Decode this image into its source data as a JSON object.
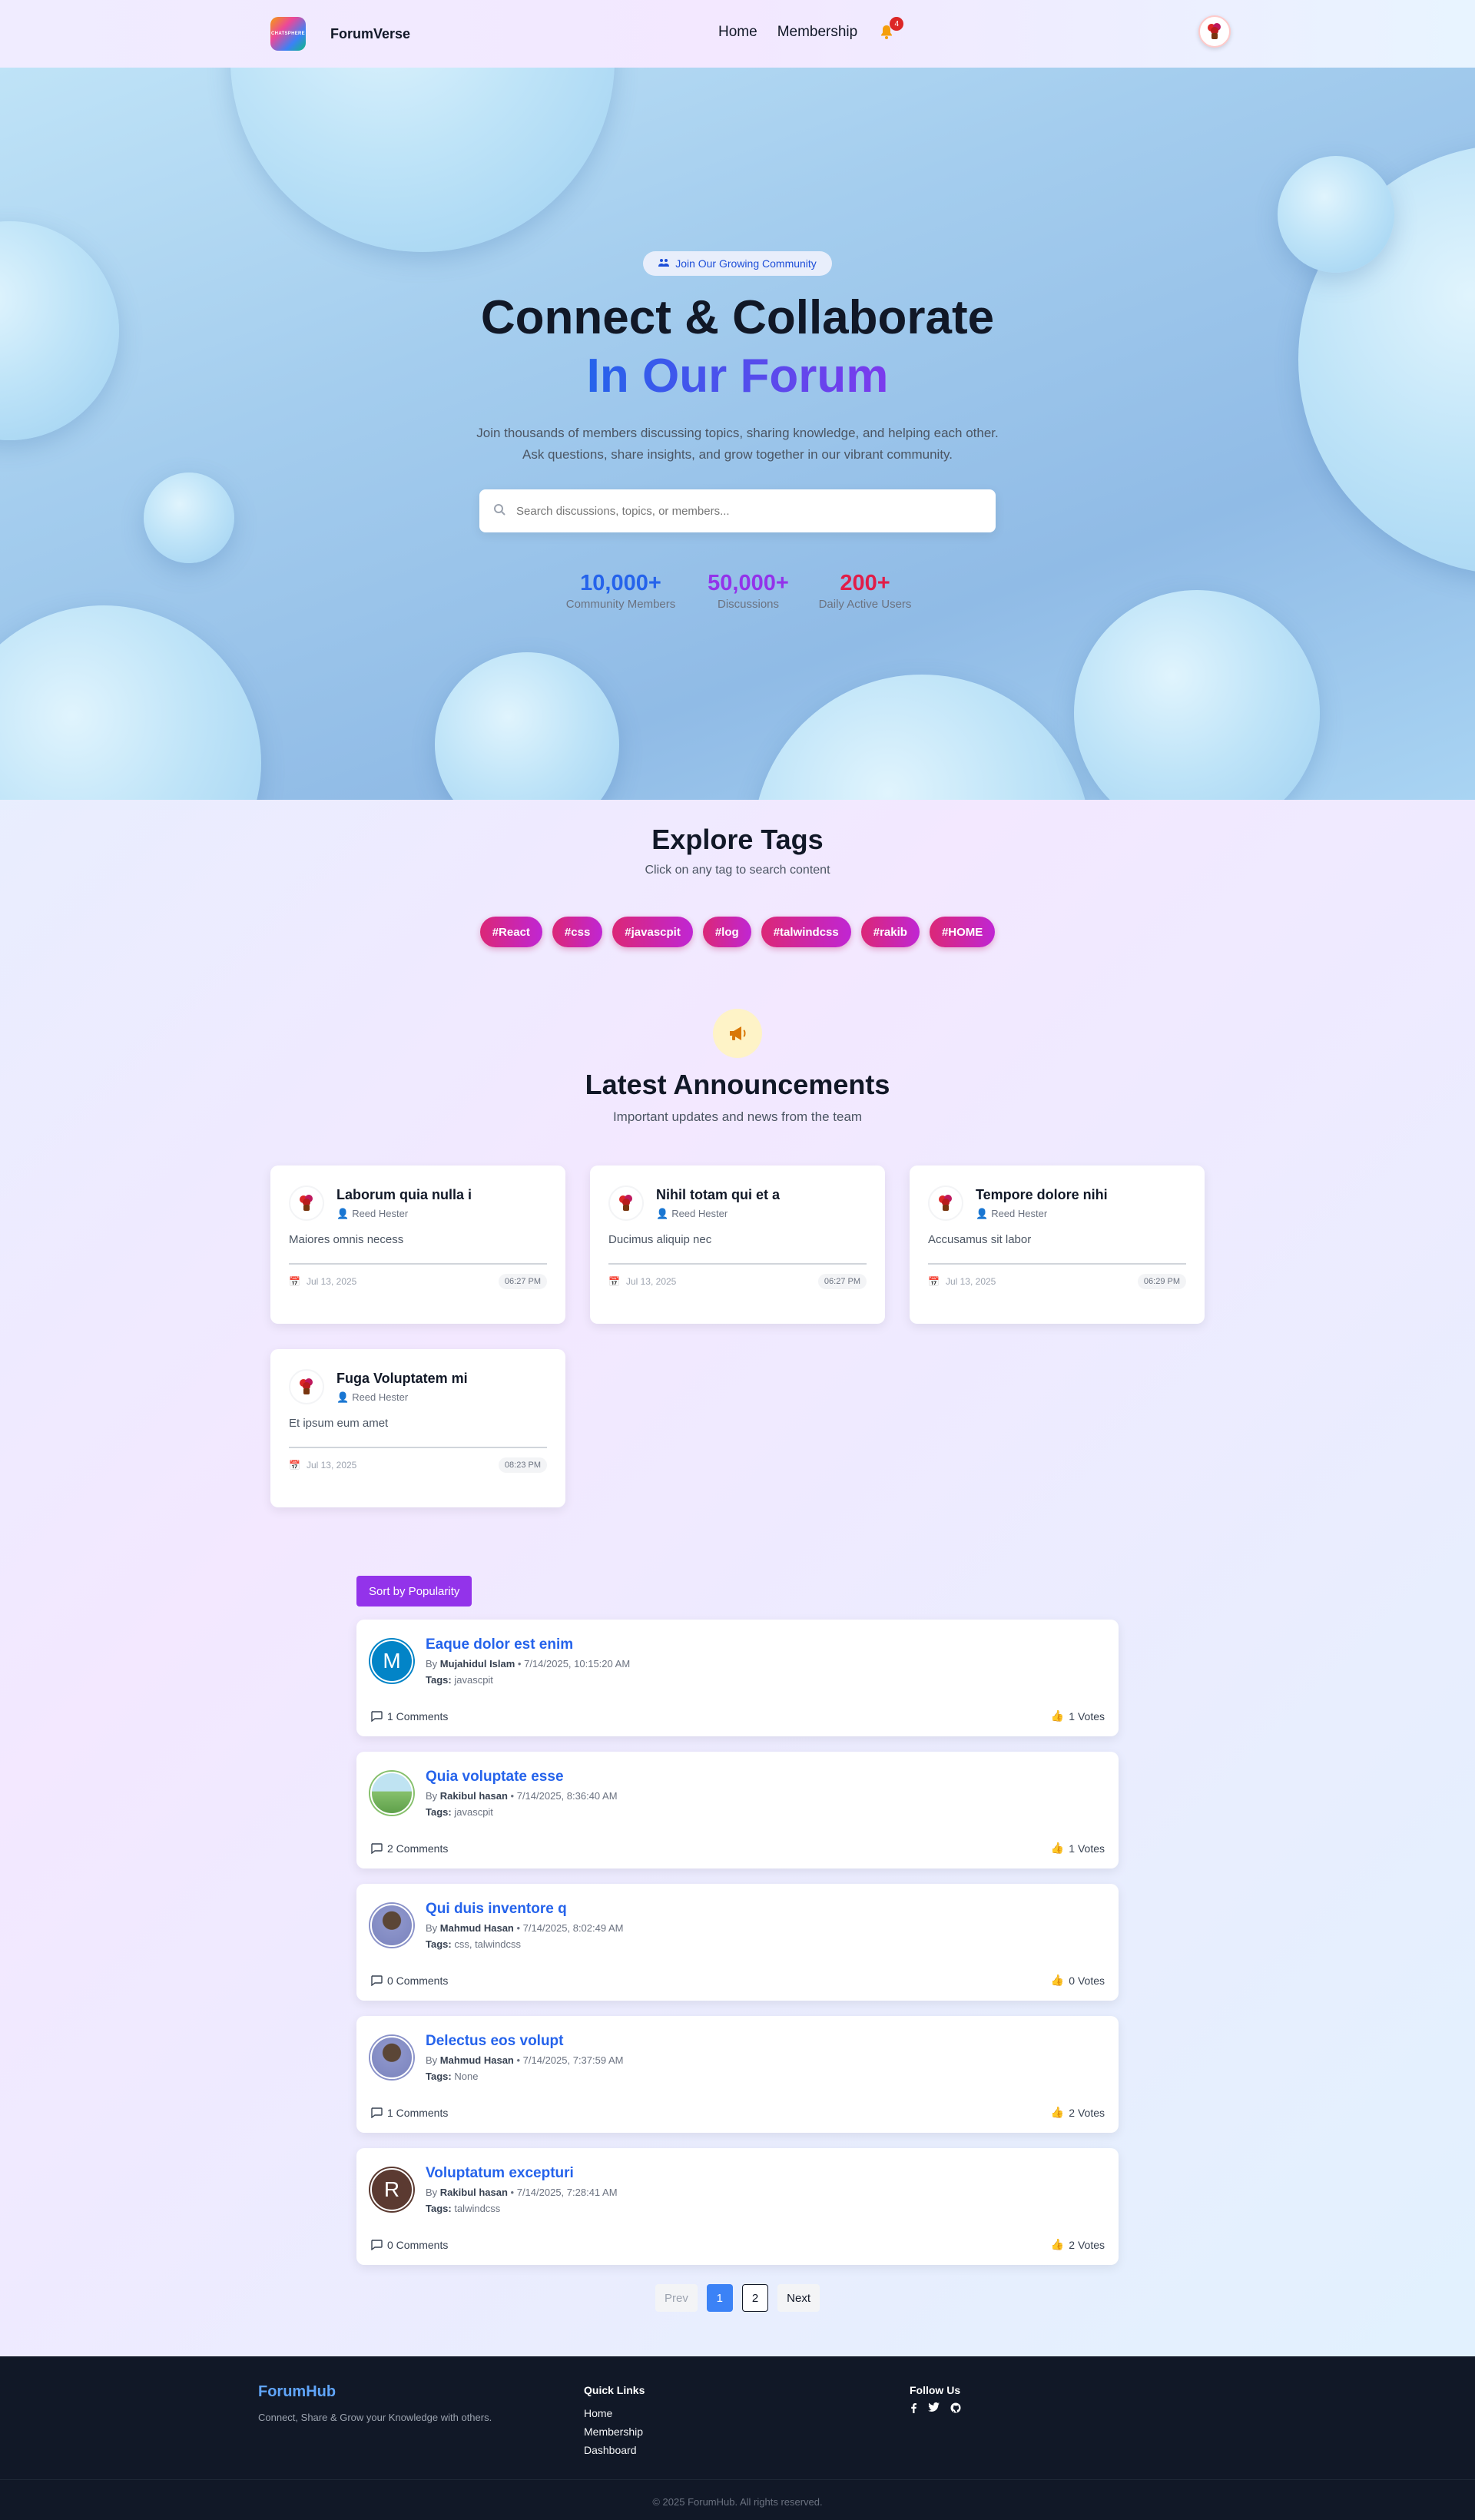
{
  "nav": {
    "logo_text": "CHATSPHERE",
    "brand": "ForumVerse",
    "links": [
      "Home",
      "Membership"
    ],
    "notification_count": "4"
  },
  "hero": {
    "badge": "Join Our Growing Community",
    "title_line1": "Connect & Collaborate",
    "title_line2": "In Our Forum",
    "description": "Join thousands of members discussing topics, sharing knowledge, and helping each other. Ask questions, share insights, and grow together in our vibrant community.",
    "search_placeholder": "Search discussions, topics, or members...",
    "stats": [
      {
        "value": "10,000+",
        "label": "Community Members",
        "color": "#2563eb"
      },
      {
        "value": "50,000+",
        "label": "Discussions",
        "color": "#9333ea"
      },
      {
        "value": "200+",
        "label": "Daily Active Users",
        "color": "#e11d48"
      }
    ]
  },
  "tags_section": {
    "title": "Explore Tags",
    "subtitle": "Click on any tag to search content",
    "tags": [
      "#React",
      "#css",
      "#javascpit",
      "#log",
      "#talwindcss",
      "#rakib",
      "#HOME"
    ]
  },
  "announcements": {
    "title": "Latest Announcements",
    "subtitle": "Important updates and news from the team",
    "items": [
      {
        "title": "Laborum quia nulla i",
        "author": "Reed Hester",
        "body": "Maiores omnis necess",
        "date": "Jul 13, 2025",
        "time": "06:27 PM"
      },
      {
        "title": "Nihil totam qui et a",
        "author": "Reed Hester",
        "body": "Ducimus aliquip nec",
        "date": "Jul 13, 2025",
        "time": "06:27 PM"
      },
      {
        "title": "Tempore dolore nihi",
        "author": "Reed Hester",
        "body": "Accusamus sit labor",
        "date": "Jul 13, 2025",
        "time": "06:29 PM"
      },
      {
        "title": "Fuga Voluptatem mi",
        "author": "Reed Hester",
        "body": "Et ipsum eum amet",
        "date": "Jul 13, 2025",
        "time": "08:23 PM"
      }
    ]
  },
  "posts": {
    "sort_label": "Sort by Popularity",
    "by_prefix": "By",
    "tags_prefix": "Tags:",
    "items": [
      {
        "title": "Eaque dolor est enim",
        "author": "Mujahidul Islam",
        "datetime": "7/14/2025, 10:15:20 AM",
        "tags": "javascpit",
        "comments": "1 Comments",
        "votes": "1 Votes",
        "avatar_letter": "M",
        "avatar_color": "#0284c7"
      },
      {
        "title": "Quia voluptate esse",
        "author": "Rakibul hasan",
        "datetime": "7/14/2025, 8:36:40 AM",
        "tags": "javascpit",
        "comments": "2 Comments",
        "votes": "1 Votes",
        "avatar_letter": "",
        "avatar_color": "#86c06c"
      },
      {
        "title": "Qui duis inventore q",
        "author": "Mahmud Hasan",
        "datetime": "7/14/2025, 8:02:49 AM",
        "tags": "css, talwindcss",
        "comments": "0 Comments",
        "votes": "0 Votes",
        "avatar_letter": "",
        "avatar_color": "#8b93c9"
      },
      {
        "title": "Delectus eos volupt",
        "author": "Mahmud Hasan",
        "datetime": "7/14/2025, 7:37:59 AM",
        "tags": "None",
        "comments": "1 Comments",
        "votes": "2 Votes",
        "avatar_letter": "",
        "avatar_color": "#8b93c9"
      },
      {
        "title": "Voluptatum excepturi",
        "author": "Rakibul hasan",
        "datetime": "7/14/2025, 7:28:41 AM",
        "tags": "talwindcss",
        "comments": "0 Comments",
        "votes": "2 Votes",
        "avatar_letter": "R",
        "avatar_color": "#5b3a31"
      }
    ]
  },
  "pagination": {
    "prev": "Prev",
    "pages": [
      "1",
      "2"
    ],
    "next": "Next"
  },
  "footer": {
    "brand": "ForumHub",
    "tagline": "Connect, Share & Grow your Knowledge with others.",
    "quick_links_title": "Quick Links",
    "quick_links": [
      "Home",
      "Membership",
      "Dashboard"
    ],
    "follow_title": "Follow Us",
    "copyright": "© 2025 ForumHub. All rights reserved."
  }
}
